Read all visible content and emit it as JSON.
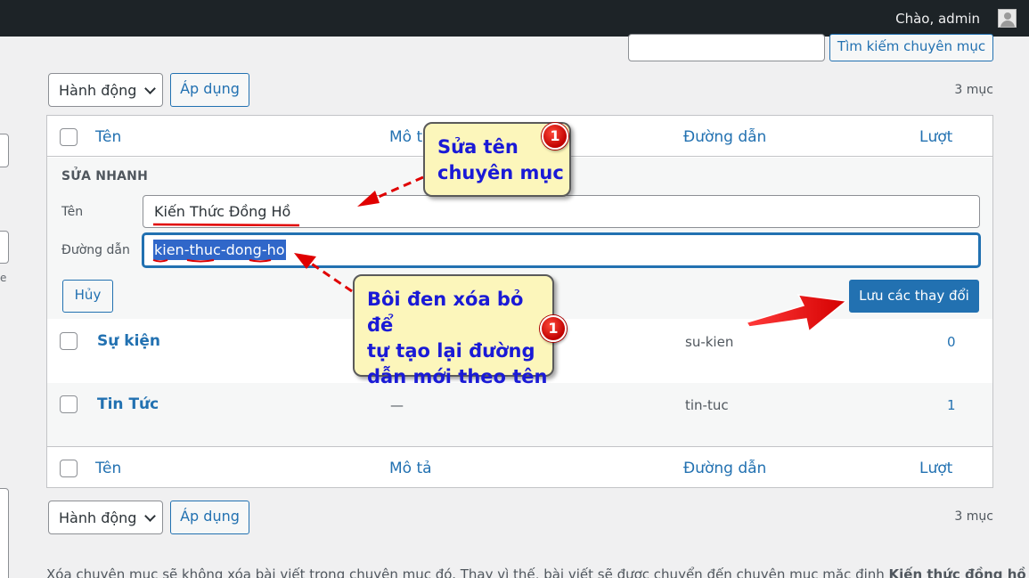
{
  "adminbar": {
    "greeting": "Chào, admin"
  },
  "search": {
    "button_label": "Tìm kiếm chuyên mục"
  },
  "bulk_top": {
    "action_label": "Hành động",
    "apply_label": "Áp dụng",
    "count": "3 mục"
  },
  "bulk_bottom": {
    "action_label": "Hành động",
    "apply_label": "Áp dụng",
    "count": "3 mục"
  },
  "columns": {
    "name": "Tên",
    "description": "Mô tả",
    "slug": "Đường dẫn",
    "count": "Lượt"
  },
  "columns_footer": {
    "name": "Tên",
    "description": "Mô tả",
    "slug": "Đường dẫn",
    "count": "Lượt"
  },
  "quick_edit": {
    "title": "SỬA NHANH",
    "name_label": "Tên",
    "name_value": "Kiến Thức Đồng Hồ",
    "slug_label": "Đường dẫn",
    "slug_value": "kien-thuc-dong-ho",
    "cancel_label": "Hủy",
    "save_label": "Lưu các thay đổi"
  },
  "rows": [
    {
      "name": "Sự kiện",
      "description": "",
      "slug": "su-kien",
      "count": "0"
    },
    {
      "name": "Tin Tức",
      "description": "—",
      "slug": "tin-tuc",
      "count": "1"
    }
  ],
  "footer_note": {
    "text": "Xóa chuyên mục sẽ không xóa bài viết trong chuyên mục đó. Thay vì thế, bài viết sẽ được chuyển đến chuyên mục mặc định ",
    "default_category": "Kiến thức đồng hồ"
  },
  "annotations": {
    "callout1_line1": "Sửa tên",
    "callout1_line2": "chuyên mục",
    "callout2_line1": "Bôi đen xóa bỏ để",
    "callout2_line2": "tự tạo lại đường",
    "callout2_line3": "dẫn mới theo tên",
    "badge1": "1",
    "badge2": "1"
  },
  "colors": {
    "accent": "#2271b1",
    "adminbar": "#1d2327",
    "callout_bg": "#fcf6bb",
    "callout_text": "#1a1ad6",
    "arrow": "#e00000"
  }
}
